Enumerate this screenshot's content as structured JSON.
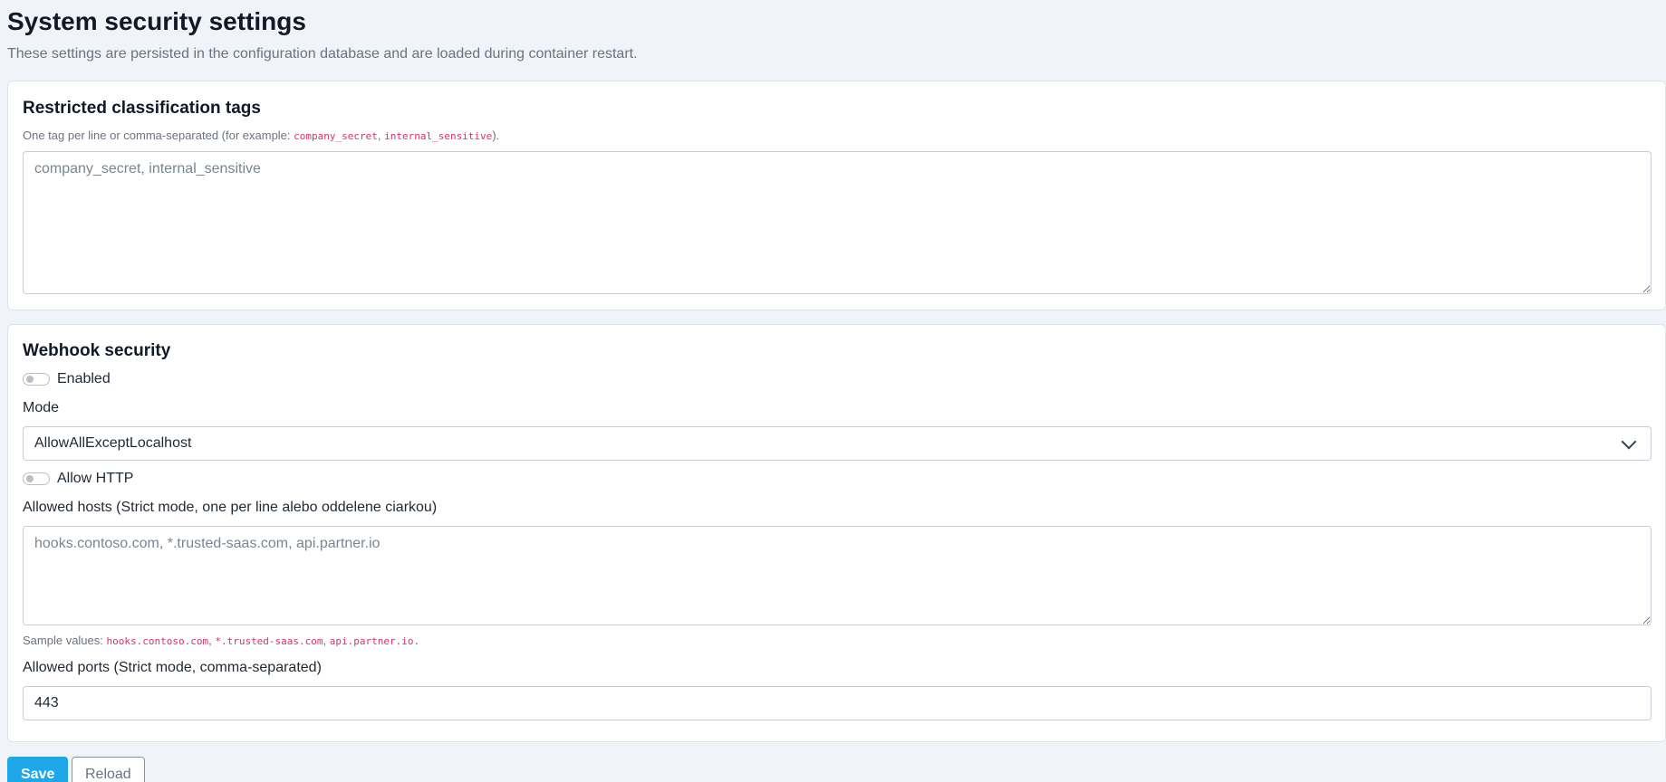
{
  "header": {
    "title": "System security settings",
    "description": "These settings are persisted in the configuration database and are loaded during container restart."
  },
  "classification": {
    "title": "Restricted classification tags",
    "help_prefix": "One tag per line or comma-separated (for example: ",
    "help_tag1": "company_secret",
    "help_sep": ", ",
    "help_tag2": "internal_sensitive",
    "help_suffix": ").",
    "placeholder": "company_secret, internal_sensitive"
  },
  "webhook": {
    "title": "Webhook security",
    "enabled_label": "Enabled",
    "enabled": false,
    "mode_label": "Mode",
    "mode_value": "AllowAllExceptLocalhost",
    "allow_http_label": "Allow HTTP",
    "allow_http": false,
    "allowed_hosts_label": "Allowed hosts (Strict mode, one per line alebo oddelene ciarkou)",
    "allowed_hosts_placeholder": "hooks.contoso.com, *.trusted-saas.com, api.partner.io",
    "sample_prefix": "Sample values: ",
    "sample1": "hooks.contoso.com",
    "sample2": "*.trusted-saas.com",
    "sample3": "api.partner.io",
    "sample_suffix": ".",
    "sep": ", ",
    "allowed_ports_label": "Allowed ports (Strict mode, comma-separated)",
    "allowed_ports_value": "443"
  },
  "actions": {
    "save_label": "Save",
    "reload_label": "Reload"
  },
  "colors": {
    "accent": "#1ea7e9",
    "code": "#d6336c",
    "background": "#f0f4f8"
  }
}
